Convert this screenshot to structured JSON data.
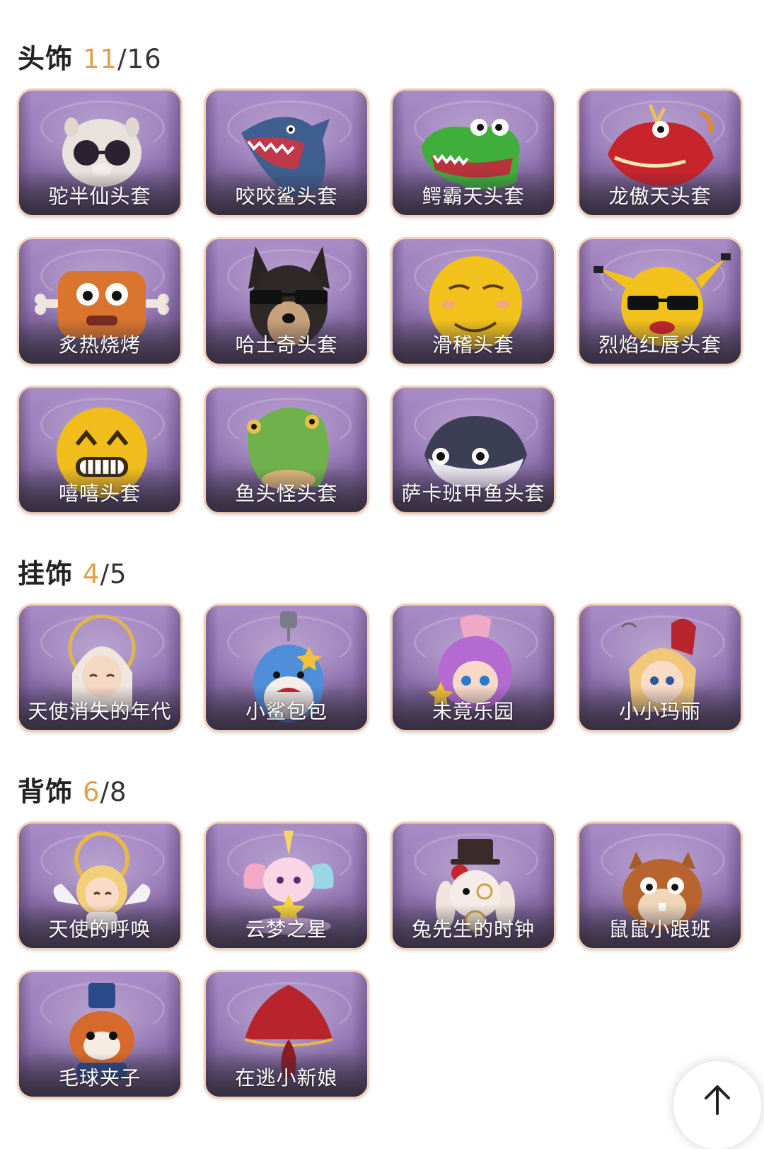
{
  "sections": {
    "headwear": {
      "title": "头饰",
      "owned": "11",
      "total": "/16",
      "items": [
        {
          "label": "驼半仙头套"
        },
        {
          "label": "咬咬鲨头套"
        },
        {
          "label": "鳄霸天头套"
        },
        {
          "label": "龙傲天头套"
        },
        {
          "label": "炙热烧烤"
        },
        {
          "label": "哈士奇头套"
        },
        {
          "label": "滑稽头套"
        },
        {
          "label": "烈焰红唇头套"
        },
        {
          "label": "嘻嘻头套"
        },
        {
          "label": "鱼头怪头套"
        },
        {
          "label": "萨卡班甲鱼头套"
        }
      ]
    },
    "pendant": {
      "title": "挂饰",
      "owned": "4",
      "total": "/5",
      "items": [
        {
          "label": "天使消失的年代"
        },
        {
          "label": "小鲨包包"
        },
        {
          "label": "未竟乐园"
        },
        {
          "label": "小小玛丽"
        }
      ]
    },
    "backpiece": {
      "title": "背饰",
      "owned": "6",
      "total": "/8",
      "items": [
        {
          "label": "天使的呼唤"
        },
        {
          "label": "云梦之星"
        },
        {
          "label": "兔先生的时钟"
        },
        {
          "label": "鼠鼠小跟班"
        },
        {
          "label": "毛球夹子"
        },
        {
          "label": "在逃小新娘"
        }
      ]
    }
  },
  "colors": {
    "owned_count": "#e0a04a",
    "card_border": "#efcfb6",
    "card_purple": "#8f70b0"
  },
  "icons": {
    "scroll_top": "arrow-up-icon"
  }
}
